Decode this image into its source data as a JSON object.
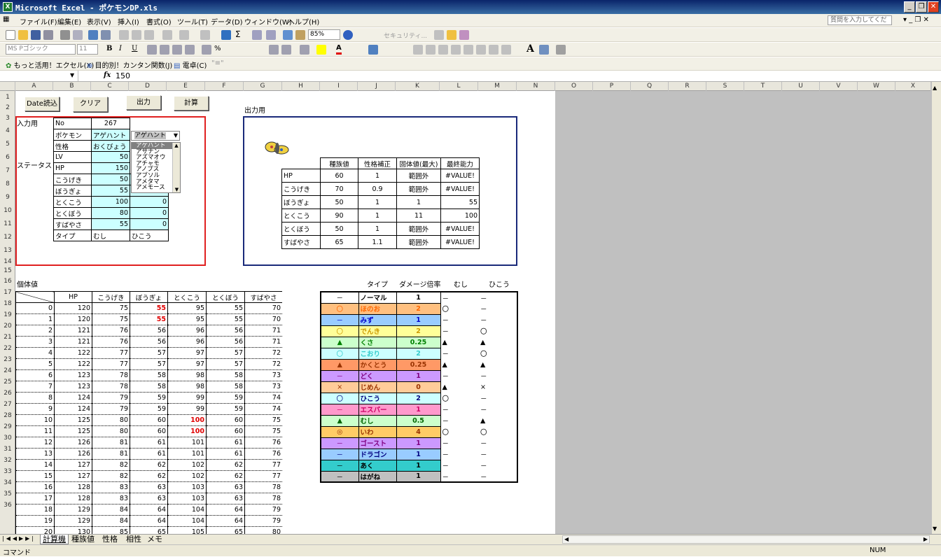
{
  "app": {
    "title": "Microsoft Excel - ポケモンDP.xls",
    "help_placeholder": "質問を入力してください"
  },
  "icons": {
    "app": "excel-icon",
    "minimize": "minimize-icon",
    "restore": "restore-icon",
    "close": "close-icon"
  },
  "menu": [
    "ファイル(F)",
    "編集(E)",
    "表示(V)",
    "挿入(I)",
    "書式(O)",
    "ツール(T)",
    "データ(D)",
    "ウィンドウ(W)",
    "ヘルプ(H)"
  ],
  "toolbar": {
    "zoom": "85%",
    "font": "MS Pゴシック",
    "size": "11",
    "security": "セキュリティ..."
  },
  "toolbar3": [
    "もっと活用！エクセル(X)",
    "目的別！カンタン関数(J)",
    "電卓(C)"
  ],
  "formula": {
    "name_box": "",
    "fx": "fx",
    "value": "150"
  },
  "columns": [
    "A",
    "B",
    "C",
    "D",
    "E",
    "F",
    "G",
    "H",
    "I",
    "J",
    "K",
    "L",
    "M",
    "N",
    "O",
    "P",
    "Q",
    "R",
    "S",
    "T",
    "U",
    "V",
    "W",
    "X"
  ],
  "rows": [
    "1",
    "2",
    "3",
    "4",
    "5",
    "6",
    "7",
    "8",
    "9",
    "10",
    "11",
    "12",
    "13",
    "14",
    "15",
    "16",
    "17",
    "18",
    "19",
    "20",
    "21",
    "22",
    "23",
    "24",
    "25",
    "26",
    "27",
    "28",
    "29",
    "30",
    "31",
    "32",
    "33",
    "34",
    "35",
    "36"
  ],
  "buttons": {
    "load": "Date読込",
    "clear": "クリア",
    "output": "出力",
    "calc": "計算"
  },
  "input": {
    "label": "入力用",
    "status_label": "ステータス",
    "no_label": "No",
    "no": "267",
    "pokemon_label": "ポケモン",
    "pokemon": "アゲハント",
    "nature_label": "性格",
    "nature": "おくびょう",
    "lv_label": "LV",
    "lv": "50",
    "hp_label": "HP",
    "hp": "150",
    "rows": [
      [
        "こうげき",
        "50",
        "0"
      ],
      [
        "ぼうぎょ",
        "55",
        "0"
      ],
      [
        "とくこう",
        "100",
        "0"
      ],
      [
        "とくぼう",
        "80",
        "0"
      ],
      [
        "すばやさ",
        "55",
        "0"
      ]
    ],
    "type_label": "タイプ",
    "type1": "むし",
    "type2": "ひこう"
  },
  "dropdown": {
    "selected": "アゲハント",
    "items": [
      "アゲハント",
      "アサナン",
      "アズマオウ",
      "アチャモ",
      "アノプス",
      "アブソル",
      "アメタマ",
      "アメモース"
    ]
  },
  "output": {
    "label": "出力用",
    "headers": [
      "",
      "種族値",
      "性格補正",
      "固体値(最大)",
      "最終能力"
    ],
    "rows": [
      [
        "HP",
        "60",
        "1",
        "範囲外",
        "#VALUE!"
      ],
      [
        "こうげき",
        "70",
        "0.9",
        "範囲外",
        "#VALUE!"
      ],
      [
        "ぼうぎょ",
        "50",
        "1",
        "1",
        "55"
      ],
      [
        "とくこう",
        "90",
        "1",
        "11",
        "100"
      ],
      [
        "とくぼう",
        "50",
        "1",
        "範囲外",
        "#VALUE!"
      ],
      [
        "すばやさ",
        "65",
        "1.1",
        "範囲外",
        "#VALUE!"
      ]
    ]
  },
  "iv": {
    "label": "個体値",
    "headers": [
      "",
      "HP",
      "こうげき",
      "ぼうぎょ",
      "とくこう",
      "とくぼう",
      "すばやさ"
    ],
    "rows": [
      [
        "0",
        "120",
        "75",
        "55",
        "95",
        "55",
        "70"
      ],
      [
        "1",
        "120",
        "75",
        "55",
        "95",
        "55",
        "70"
      ],
      [
        "2",
        "121",
        "76",
        "56",
        "96",
        "56",
        "71"
      ],
      [
        "3",
        "121",
        "76",
        "56",
        "96",
        "56",
        "71"
      ],
      [
        "4",
        "122",
        "77",
        "57",
        "97",
        "57",
        "72"
      ],
      [
        "5",
        "122",
        "77",
        "57",
        "97",
        "57",
        "72"
      ],
      [
        "6",
        "123",
        "78",
        "58",
        "98",
        "58",
        "73"
      ],
      [
        "7",
        "123",
        "78",
        "58",
        "98",
        "58",
        "73"
      ],
      [
        "8",
        "124",
        "79",
        "59",
        "99",
        "59",
        "74"
      ],
      [
        "9",
        "124",
        "79",
        "59",
        "99",
        "59",
        "74"
      ],
      [
        "10",
        "125",
        "80",
        "60",
        "100",
        "60",
        "75"
      ],
      [
        "11",
        "125",
        "80",
        "60",
        "100",
        "60",
        "75"
      ],
      [
        "12",
        "126",
        "81",
        "61",
        "101",
        "61",
        "76"
      ],
      [
        "13",
        "126",
        "81",
        "61",
        "101",
        "61",
        "76"
      ],
      [
        "14",
        "127",
        "82",
        "62",
        "102",
        "62",
        "77"
      ],
      [
        "15",
        "127",
        "82",
        "62",
        "102",
        "62",
        "77"
      ],
      [
        "16",
        "128",
        "83",
        "63",
        "103",
        "63",
        "78"
      ],
      [
        "17",
        "128",
        "83",
        "63",
        "103",
        "63",
        "78"
      ],
      [
        "18",
        "129",
        "84",
        "64",
        "104",
        "64",
        "79"
      ],
      [
        "19",
        "129",
        "84",
        "64",
        "104",
        "64",
        "79"
      ],
      [
        "20",
        "130",
        "85",
        "65",
        "105",
        "65",
        "80"
      ]
    ]
  },
  "types": {
    "headers": [
      "",
      "タイプ",
      "ダメージ倍率",
      "むし",
      "ひこう"
    ],
    "rows": [
      {
        "mark": "－",
        "name": "ノーマル",
        "rate": "1",
        "a": "－",
        "b": "－",
        "bg": "#ffffff",
        "fg": "#000000"
      },
      {
        "mark": "〇",
        "name": "ほのお",
        "rate": "2",
        "a": "〇",
        "b": "－",
        "bg": "#ffc080",
        "fg": "#ff6600"
      },
      {
        "mark": "－",
        "name": "みず",
        "rate": "1",
        "a": "－",
        "b": "－",
        "bg": "#99ccff",
        "fg": "#0000cc"
      },
      {
        "mark": "〇",
        "name": "でんき",
        "rate": "2",
        "a": "－",
        "b": "〇",
        "bg": "#ffff99",
        "fg": "#cc9900"
      },
      {
        "mark": "▲",
        "name": "くさ",
        "rate": "0.25",
        "a": "▲",
        "b": "▲",
        "bg": "#ccffcc",
        "fg": "#008000"
      },
      {
        "mark": "〇",
        "name": "こおり",
        "rate": "2",
        "a": "－",
        "b": "〇",
        "bg": "#ccffff",
        "fg": "#33cccc"
      },
      {
        "mark": "▲",
        "name": "かくとう",
        "rate": "0.25",
        "a": "▲",
        "b": "▲",
        "bg": "#ff9966",
        "fg": "#993300"
      },
      {
        "mark": "－",
        "name": "どく",
        "rate": "1",
        "a": "－",
        "b": "－",
        "bg": "#cc99ff",
        "fg": "#800080"
      },
      {
        "mark": "×",
        "name": "じめん",
        "rate": "0",
        "a": "▲",
        "b": "×",
        "bg": "#ffcc99",
        "fg": "#993300"
      },
      {
        "mark": "〇",
        "name": "ひこう",
        "rate": "2",
        "a": "〇",
        "b": "－",
        "bg": "#ccffff",
        "fg": "#000080"
      },
      {
        "mark": "－",
        "name": "エスパー",
        "rate": "1",
        "a": "－",
        "b": "－",
        "bg": "#ff99cc",
        "fg": "#cc0066"
      },
      {
        "mark": "▲",
        "name": "むし",
        "rate": "0.5",
        "a": "－",
        "b": "▲",
        "bg": "#ccffcc",
        "fg": "#006600"
      },
      {
        "mark": "◎",
        "name": "いわ",
        "rate": "4",
        "a": "〇",
        "b": "〇",
        "bg": "#ffcc66",
        "fg": "#993300"
      },
      {
        "mark": "－",
        "name": "ゴースト",
        "rate": "1",
        "a": "－",
        "b": "－",
        "bg": "#cc99ff",
        "fg": "#800080"
      },
      {
        "mark": "－",
        "name": "ドラゴン",
        "rate": "1",
        "a": "－",
        "b": "－",
        "bg": "#99ccff",
        "fg": "#000080"
      },
      {
        "mark": "－",
        "name": "あく",
        "rate": "1",
        "a": "－",
        "b": "－",
        "bg": "#33cccc",
        "fg": "#000000"
      },
      {
        "mark": "－",
        "name": "はがね",
        "rate": "1",
        "a": "－",
        "b": "－",
        "bg": "#c0c0c0",
        "fg": "#000000"
      }
    ]
  },
  "sheets": [
    "計算機",
    "種族値",
    "性格",
    "相性",
    "メモ"
  ],
  "status": {
    "left": "コマンド",
    "right": "NUM"
  }
}
